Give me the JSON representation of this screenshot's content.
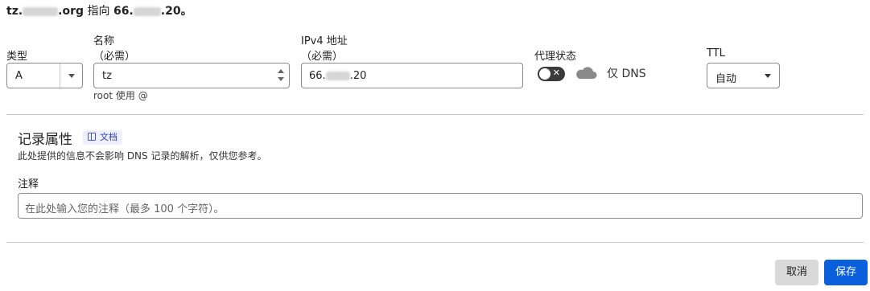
{
  "summary": {
    "prefix": "tz.",
    "suffix": ".org",
    "verb": "指向",
    "ip_prefix": "66.",
    "ip_suffix": ".20。"
  },
  "fields": {
    "type_label": "类型",
    "type_value": "A",
    "name_label": "名称",
    "name_required": "（必需）",
    "name_value": "tz",
    "name_hint": "root 使用 @",
    "ipv4_label": "IPv4 地址",
    "ipv4_required": "（必需）",
    "ipv4_prefix": "66.",
    "ipv4_suffix": ".20",
    "proxy_label": "代理状态",
    "proxy_toggle_glyph": "✕",
    "proxy_text": "仅 DNS",
    "ttl_label": "TTL",
    "ttl_value": "自动"
  },
  "record_props": {
    "title": "记录属性",
    "doc_badge": "文档",
    "description": "此处提供的信息不会影响 DNS 记录的解析，仅供您参考。",
    "comment_label": "注释",
    "comment_placeholder": "在此处输入您的注释（最多 100 个字符）。"
  },
  "actions": {
    "cancel": "取消",
    "save": "保存"
  },
  "colors": {
    "save_bg": "#0a5fdc",
    "cancel_bg": "#d9d9d9",
    "badge_bg": "#eef0ff"
  }
}
